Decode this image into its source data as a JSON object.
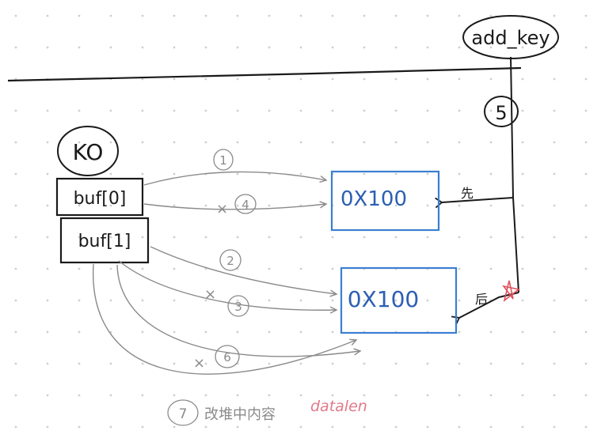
{
  "diagram": {
    "add_key": {
      "label": "add_key",
      "step": "5"
    },
    "ko": {
      "label": "KO"
    },
    "buffers": [
      {
        "label": "buf[0]"
      },
      {
        "label": "buf[1]"
      }
    ],
    "boxes": [
      {
        "label": "0X100"
      },
      {
        "label": "0X100"
      }
    ],
    "arrow_labels": {
      "first": "先",
      "after": "后"
    },
    "steps": {
      "s1": "1",
      "s2": "2",
      "s3": "3",
      "s4": "4",
      "s6": "6",
      "s7": "7"
    },
    "step7_note": "改堆中内容",
    "step7_field": "datalen",
    "colors": {
      "ink": "#1a1a1a",
      "pencil": "#8a8a8a",
      "blue_box": "#3b7fd1",
      "blue_text": "#2c5fb3",
      "red_star": "#e0505a",
      "pink_text": "#e07a8a",
      "grid_dot": "#cfcfcf"
    }
  }
}
